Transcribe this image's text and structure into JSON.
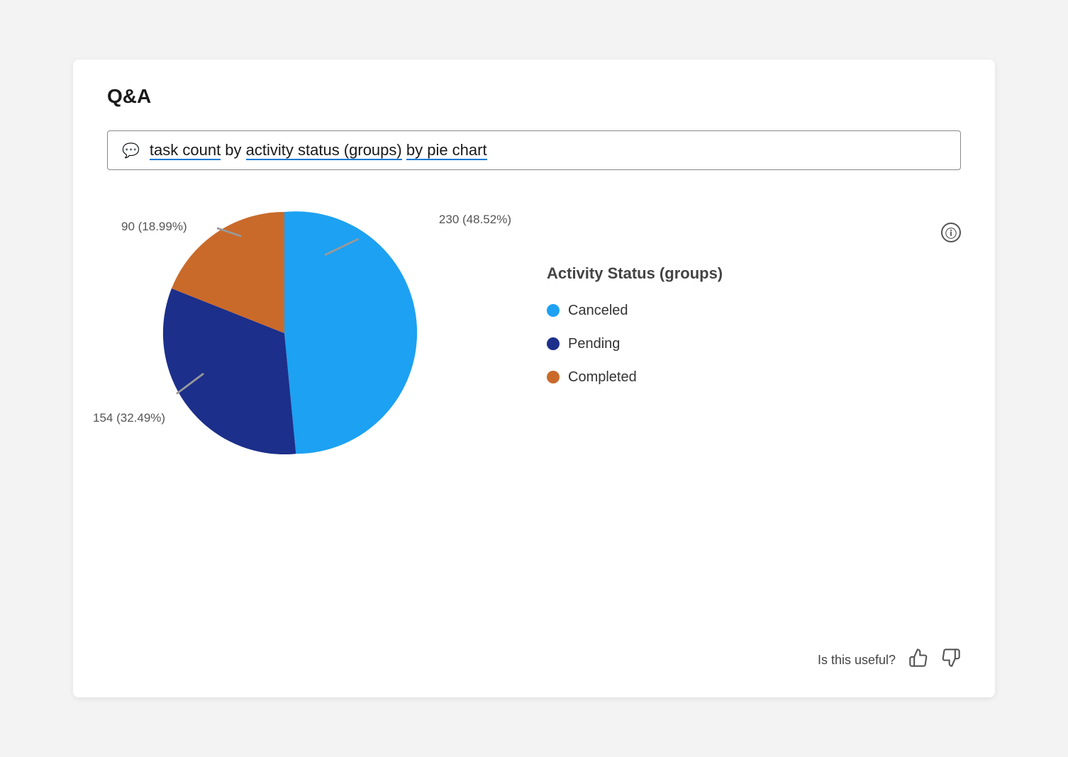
{
  "title": "Q&A",
  "search": {
    "icon": "💬",
    "text_parts": [
      "task count by activity status (groups) by pie chart"
    ],
    "underlined_words": [
      "task count",
      "activity status (groups)",
      "by pie chart"
    ]
  },
  "chart": {
    "title": "Activity Status (groups)",
    "slices": [
      {
        "label": "Canceled",
        "value": 230,
        "percent": 48.52,
        "color": "#1da1f2",
        "start_angle": -90,
        "end_angle": 84.7
      },
      {
        "label": "Pending",
        "value": 154,
        "percent": 32.49,
        "color": "#1c2f8a",
        "start_angle": 84.7,
        "end_angle": 201.7
      },
      {
        "label": "Completed",
        "value": 90,
        "percent": 18.99,
        "color": "#c96a2b",
        "start_angle": 201.7,
        "end_angle": 270
      }
    ],
    "labels": [
      {
        "id": "canceled-label",
        "text": "230 (48.52%)"
      },
      {
        "id": "pending-label",
        "text": "154 (32.49%)"
      },
      {
        "id": "completed-label",
        "text": "90 (18.99%)"
      }
    ]
  },
  "footer": {
    "question": "Is this useful?",
    "thumbs_up_label": "👍",
    "thumbs_down_label": "👎"
  }
}
